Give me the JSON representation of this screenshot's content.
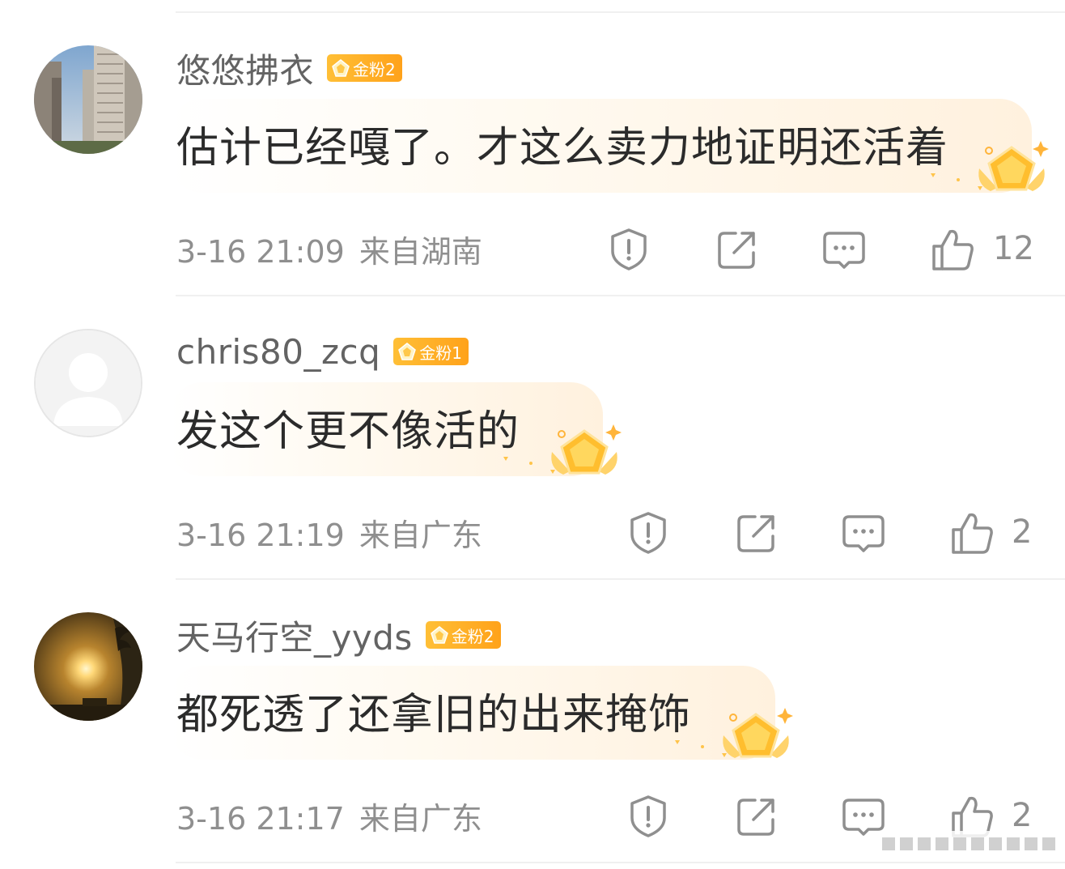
{
  "comments": [
    {
      "username": "悠悠拂衣",
      "badge": "金粉2",
      "text": "估计已经嘎了。才这么卖力地证明还活着",
      "time": "3-16 21:09",
      "location": "来自湖南",
      "likes": "12",
      "avatar": "buildings-photo"
    },
    {
      "username": "chris80_zcq",
      "badge": "金粉1",
      "text": "发这个更不像活的",
      "time": "3-16 21:19",
      "location": "来自广东",
      "likes": "2",
      "avatar": "default-silhouette"
    },
    {
      "username": "天马行空_yyds",
      "badge": "金粉2",
      "text": "都死透了还拿旧的出来掩饰",
      "time": "3-16 21:17",
      "location": "来自广东",
      "likes": "2",
      "avatar": "sunset-photo"
    }
  ],
  "icons": [
    "report-icon",
    "share-icon",
    "reply-icon",
    "like-icon",
    "gold-fan-badge-icon"
  ],
  "colors": {
    "badge": "#ffa21a",
    "text": "#2b2b2b",
    "meta": "#8f8f8f",
    "name": "#636363"
  }
}
